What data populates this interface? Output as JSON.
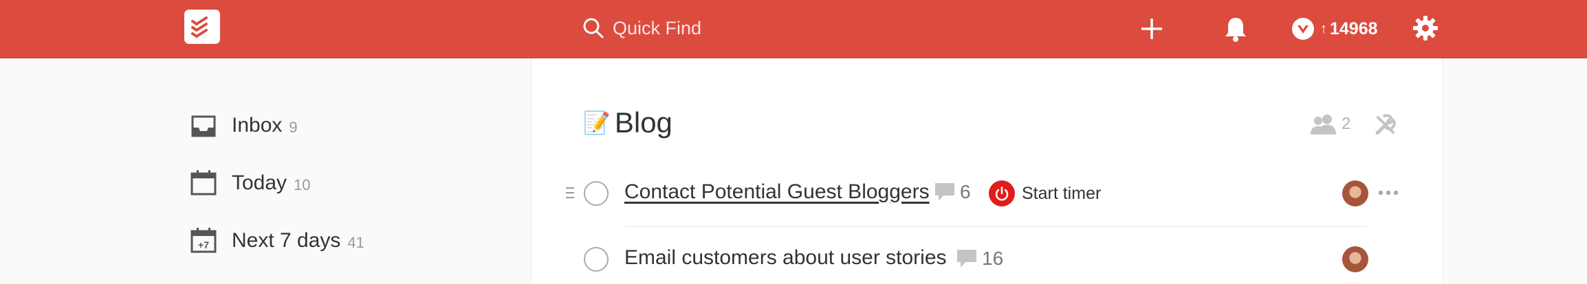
{
  "header": {
    "search_placeholder": "Quick Find",
    "karma_score": "14968",
    "karma_arrow": "↑",
    "accent_color": "#db4c3f"
  },
  "sidebar": {
    "items": [
      {
        "label": "Inbox",
        "count": "9",
        "icon": "inbox-icon"
      },
      {
        "label": "Today",
        "count": "10",
        "icon": "calendar-today-icon"
      },
      {
        "label": "Next 7 days",
        "count": "41",
        "icon": "calendar-next-7-icon",
        "icon_text": "+7"
      }
    ]
  },
  "project": {
    "emoji": "📝",
    "name": "Blog",
    "collaborators_count": "2"
  },
  "tasks": [
    {
      "title": "Contact Potential Guest Bloggers",
      "comments": "6",
      "timer_label": "Start timer"
    },
    {
      "title": "Email customers about user stories",
      "comments": "16"
    }
  ]
}
